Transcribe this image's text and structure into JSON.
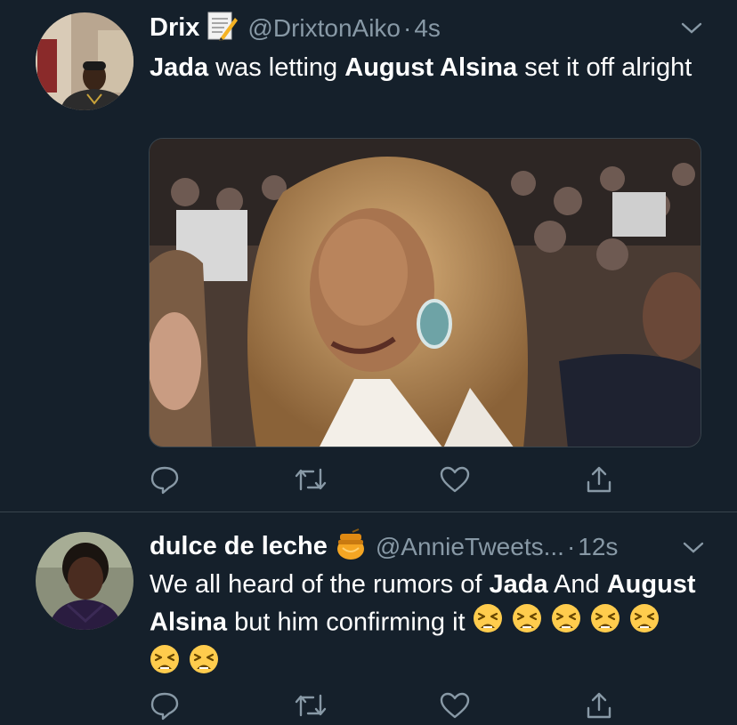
{
  "tweets": [
    {
      "name": "Drix",
      "badge_icon": "memo-emoji",
      "handle": "@DrixtonAiko",
      "sep": "·",
      "time": "4s",
      "text_parts": [
        {
          "t": "Jada",
          "bold": true
        },
        {
          "t": " was letting ",
          "bold": false
        },
        {
          "t": "August Alsina",
          "bold": true
        },
        {
          "t": " set it off alright",
          "bold": false
        }
      ],
      "media": "gif-image-woman-at-awards-crowd"
    },
    {
      "name": "dulce de leche",
      "badge_icon": "honey-pot-emoji",
      "handle": "@AnnieTweets...",
      "sep": "·",
      "time": "12s",
      "text_parts": [
        {
          "t": "We all heard of the rumors of ",
          "bold": false
        },
        {
          "t": "Jada",
          "bold": true
        },
        {
          "t": " And ",
          "bold": false
        },
        {
          "t": "August Alsina",
          "bold": true
        },
        {
          "t": " but him confirming it ",
          "bold": false
        }
      ],
      "emoji_count": 7,
      "emoji_name": "tired-face-emoji"
    }
  ],
  "actions": [
    "reply-icon",
    "retweet-icon",
    "like-icon",
    "share-icon"
  ],
  "colors": {
    "background": "#15202b",
    "secondary_text": "#8899a6",
    "divider": "#38444d",
    "primary_text": "#ffffff"
  }
}
